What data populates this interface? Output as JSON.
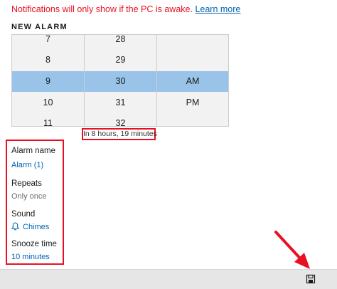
{
  "notice": {
    "text": "Notifications will only show if the PC is awake.",
    "link": "Learn more"
  },
  "section_title": "NEW ALARM",
  "time_picker": {
    "hours": [
      "7",
      "8",
      "9",
      "10",
      "11"
    ],
    "minutes": [
      "28",
      "29",
      "30",
      "31",
      "32"
    ],
    "periods": [
      "",
      "",
      "AM",
      "PM",
      ""
    ],
    "selected": {
      "hour": "9",
      "minute": "30",
      "period": "AM"
    }
  },
  "countdown": "In 8 hours, 19 minutes",
  "settings": {
    "alarm_name": {
      "label": "Alarm name",
      "value": "Alarm (1)"
    },
    "repeats": {
      "label": "Repeats",
      "value": "Only once"
    },
    "sound": {
      "label": "Sound",
      "value": "Chimes"
    },
    "snooze": {
      "label": "Snooze time",
      "value": "10 minutes"
    }
  },
  "colors": {
    "accent": "#0063b1",
    "selection": "#99c3e8",
    "annotation": "#e81123"
  },
  "icons": {
    "sound": "bell-icon",
    "save": "save-icon"
  }
}
